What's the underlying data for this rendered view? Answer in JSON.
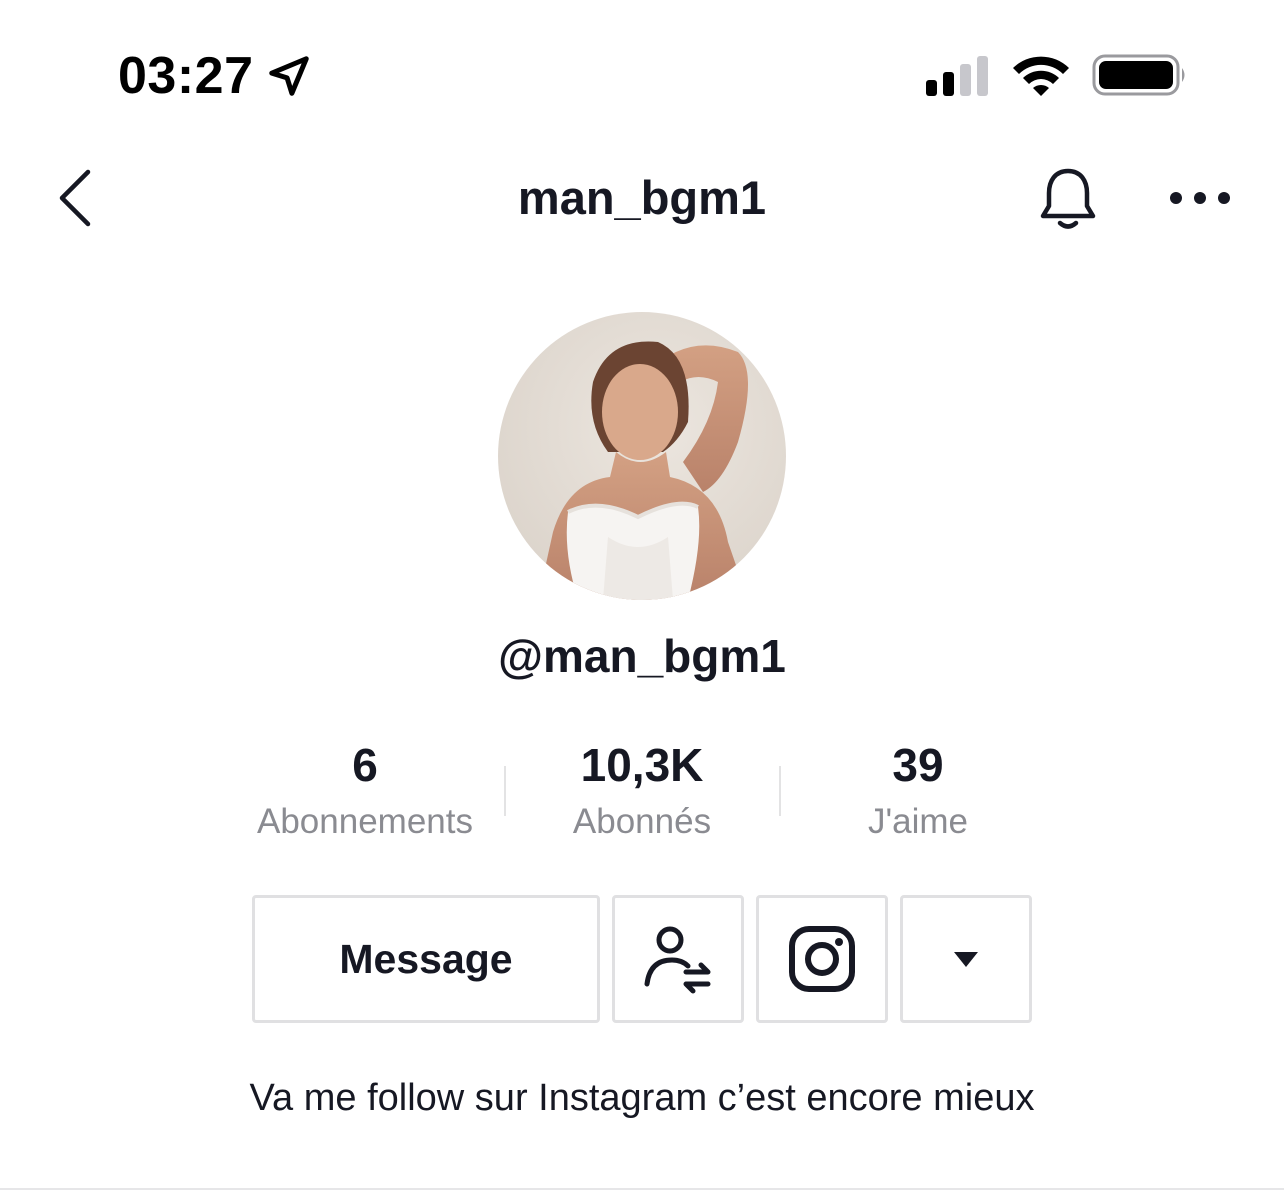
{
  "status_bar": {
    "time": "03:27",
    "location_icon": "location-arrow-icon",
    "signal_icon": "cellular-signal-icon",
    "wifi_icon": "wifi-icon",
    "battery_icon": "battery-icon"
  },
  "header": {
    "title": "man_bgm1",
    "back_icon": "chevron-left-icon",
    "bell_icon": "bell-icon",
    "more_icon": "more-horizontal-icon"
  },
  "profile": {
    "handle": "@man_bgm1",
    "stats": {
      "following": {
        "value": "6",
        "label": "Abonnements"
      },
      "followers": {
        "value": "10,3K",
        "label": "Abonnés"
      },
      "likes": {
        "value": "39",
        "label": "J'aime"
      }
    },
    "buttons": {
      "message_label": "Message",
      "friends_icon": "user-swap-icon",
      "instagram_icon": "instagram-icon",
      "dropdown_icon": "caret-down-icon"
    },
    "bio": "Va me follow sur Instagram c’est encore mieux"
  },
  "colors": {
    "text_primary": "#161823",
    "text_secondary": "#8a8b91",
    "border": "#e0e0e2"
  }
}
